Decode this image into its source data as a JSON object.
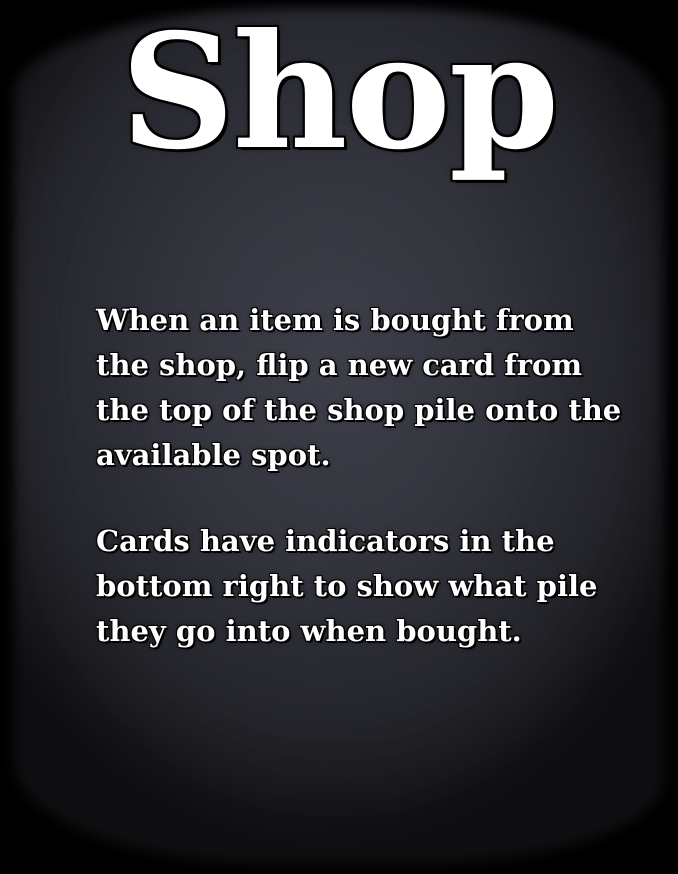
{
  "title": "Shop",
  "paragraphs": [
    {
      "lines": [
        "When an item is bought from",
        "the shop, flip a new card from",
        "the top of the shop pile onto the",
        "available spot."
      ]
    },
    {
      "lines": [
        "Cards have indicators in the",
        "bottom right to show what pile",
        "they go into when bought."
      ]
    }
  ],
  "colors": {
    "background": "#000000",
    "panel": "#3d3e48",
    "text": "#ffffff",
    "outline": "#000000"
  }
}
